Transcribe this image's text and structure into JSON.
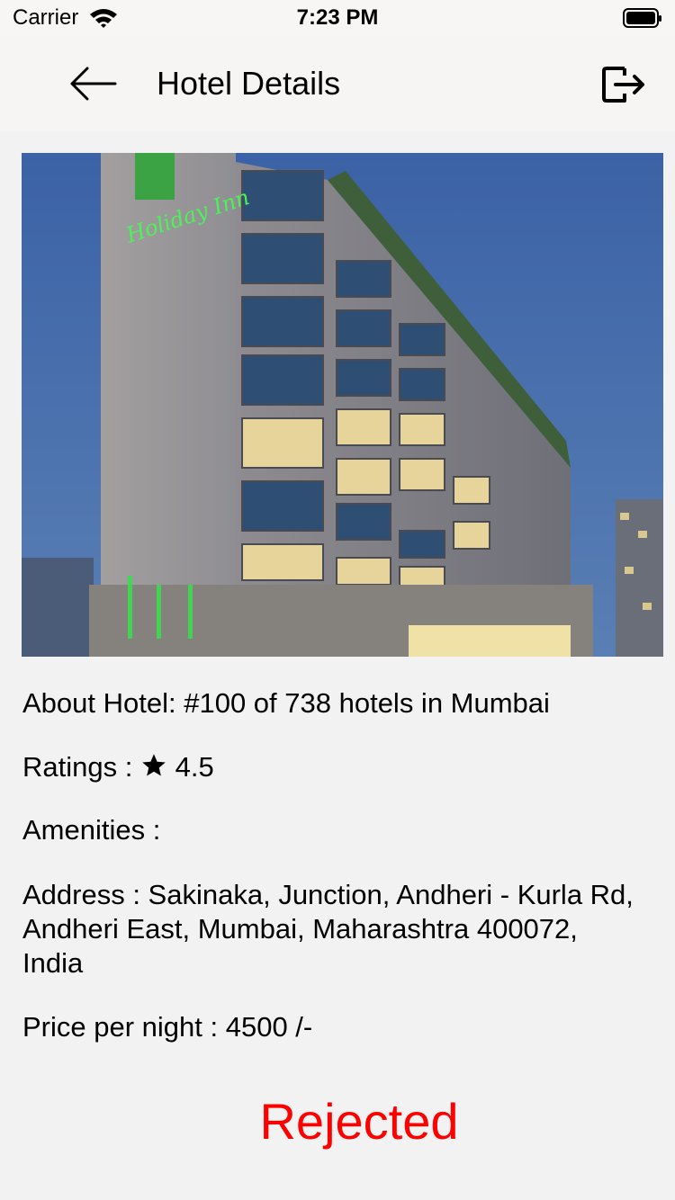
{
  "status_bar": {
    "carrier": "Carrier",
    "time": "7:23 PM"
  },
  "nav": {
    "title": "Hotel Details",
    "back_icon": "arrow-left-icon",
    "logout_icon": "logout-icon"
  },
  "hotel": {
    "image_alt": "Holiday Inn hotel building at dusk",
    "sign_text": "Holiday Inn",
    "about": "About Hotel: #100 of 738 hotels in Mumbai",
    "ratings_label": "Ratings :",
    "rating_value": "4.5",
    "amenities": "Amenities :",
    "address": "Address : Sakinaka, Junction, Andheri - Kurla Rd, Andheri East, Mumbai, Maharashtra 400072, India",
    "price": "Price per night : 4500 /-",
    "status": "Rejected"
  },
  "colors": {
    "status": "#ff0000",
    "nav_background": "#f7f5f4",
    "page_background": "#f2f2f2"
  }
}
